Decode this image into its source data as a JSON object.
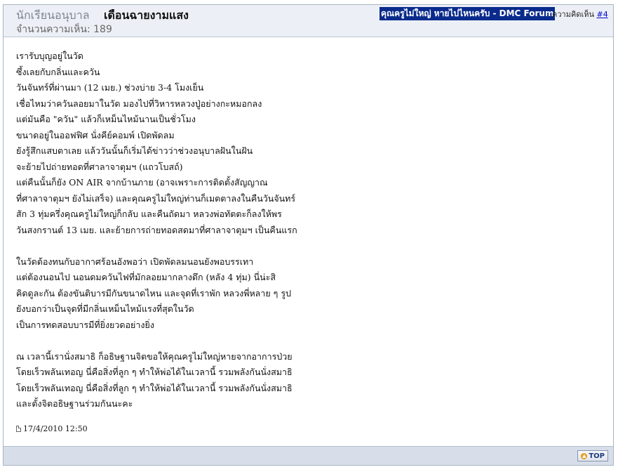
{
  "header": {
    "poster_name": "นักเรียนอนุบาล",
    "title": "เดือนฉายงามแสง",
    "comment_count": "จำนวนความเห็น: 189",
    "forum_link": "คุณครูไม่ใหญ่ หายไปไหนครับ - DMC Forum",
    "comment_label": "ความคิดเห็น",
    "comment_number": "#4"
  },
  "post": {
    "lines": [
      "เรารับบุญอยู่ในวัด",
      "ซึ้งเลยกับกลิ่นและควัน",
      "วันจันทร์ที่ผ่านมา (12 เมย.) ช่วงบ่าย 3-4 โมงเย็น",
      "เชื่อไหมว่าควันลอยมาในวัด มองไปที่วิหารหลวงปู่อย่างกะหมอกลง",
      "แต่มันคือ \"ควัน\" แล้วก็เหม็นไหม้นานเป็นชั่วโมง",
      "ขนาดอยู่ในออฟฟิศ นั่งคีย์คอมพ์ เปิดพัดลม",
      "ยังรู้สึกแสบตาเลย แล้ววันนั้นก็เริ่มได้ข่าวว่าช่วงอนุบาลฝันในฝัน",
      "จะย้ายไปถ่ายทอดที่ศาลาจาตุมฯ (แถวโบสถ์)",
      "แต่คืนนั้นก็ยัง ON AIR จากบ้านภาย (อาจเพราะการติดตั้งสัญญาณ",
      "ที่ศาลาจาตุมฯ ยังไม่เสร็จ) และคุณครูไม่ใหญ่ท่านก็เมตตาลงในคืนวันจันทร์",
      "สัก 3 ทุ่มครึ่งคุณครูไม่ใหญ่ก็กลับ และคืนถัดมา หลวงพ่อทัตตะก็ลงให้พร",
      "วันสงกรานต์ 13 เมย. และย้ายการถ่ายทอดสดมาที่ศาลาจาตุมฯ เป็นคืนแรก",
      "",
      "ในวัดต้องทนกับอากาศร้อนอังพอว่า เปิดพัดลมนอนยังพอบรรเทา",
      "แต่ต้องนอนไป นอนดมควันไฟที่มักลอยมากลางดึก (หลัง 4 ทุ่ม) นี่น่ะสิ",
      "คิดดูละกัน ต้องขันติบารมีกันขนาดไหน และจุดที่เราพัก หลวงพี่หลาย ๆ รูป",
      "ยังบอกว่าเป็นจุดที่มีกลิ่นเหม็นไหม้แรงที่สุดในวัด",
      "เป็นการทดสอบบารมีที่ยิ่งยวดอย่างยิ่ง",
      "",
      "ณ เวลานี้เรานั่งสมาธิ ก็อธิษฐานจิตขอให้คุณครูไม่ใหญ่หายจากอาการป่วย",
      "โดยเร็วพลันเทอญ นี่คือสิ่งที่ลูก ๆ ทำให้พ่อได้ในเวลานี้ รวมพลังกันนั่งสมาธิ",
      "โดยเร็วพลันเทอญ นี่คือสิ่งที่ลูก ๆ ทำให้พ่อได้ในเวลานี้ รวมพลังกันนั่งสมาธิ",
      "และตั้งจิตอธิษฐานร่วมกันนะคะ"
    ],
    "timestamp": "17/4/2010 12:50"
  },
  "footer": {
    "top_label": "TOP"
  },
  "icons": {
    "timestamp_icon": "document-icon",
    "top_icon": "arrow-up-icon"
  },
  "colors": {
    "header_bg": "#ecf0f6",
    "forum_link_bg": "#0a2b8c",
    "footer_bg": "#d7deea",
    "link": "#0000cc"
  }
}
